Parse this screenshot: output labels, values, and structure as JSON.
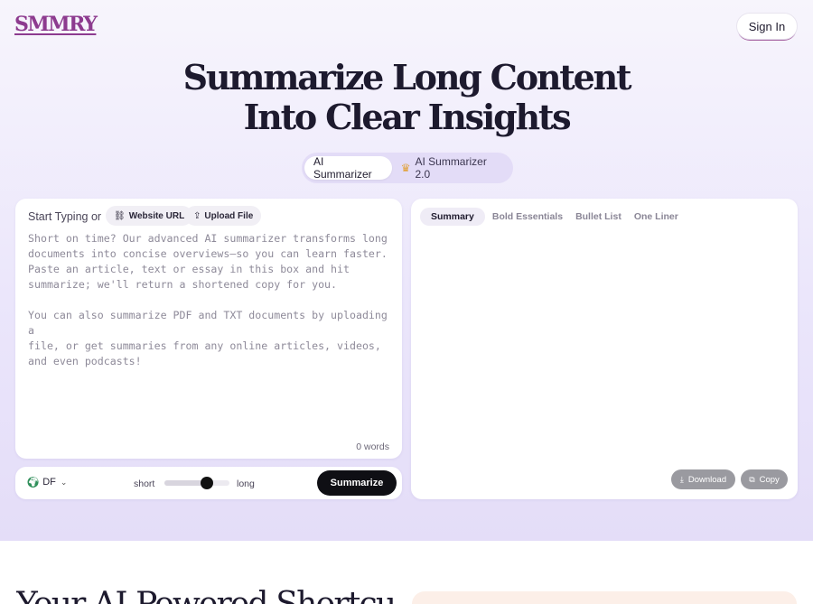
{
  "header": {
    "logo": "SMMRY",
    "signin_label": "Sign In"
  },
  "hero": {
    "title_line1": "Summarize Long Content",
    "title_line2_part1": "Into ",
    "title_line2_part2": "Clear Insights"
  },
  "mode_toggle": {
    "options": [
      {
        "label": "AI Summarizer",
        "active": true
      },
      {
        "label": "AI Summarizer 2.0",
        "icon": "crown-icon",
        "active": false
      }
    ]
  },
  "input": {
    "start_label": "Start Typing or",
    "website_url_label": "Website URL",
    "upload_file_label": "Upload File",
    "placeholder": "Short on time? Our advanced AI summarizer transforms long\ndocuments into concise overviews—so you can learn faster.\nPaste an article, text or essay in this box and hit\nsummarize; we'll return a shortened copy for you.\n\nYou can also summarize PDF and TXT documents by uploading a\nfile, or get summaries from any online articles, videos,\nand even podcasts!",
    "word_count": "0 words"
  },
  "controls": {
    "language": "DF",
    "short_label": "short",
    "long_label": "long",
    "length_level": 0.65,
    "summarize_label": "Summarize"
  },
  "output": {
    "tabs": [
      {
        "label": "Summary",
        "active": true
      },
      {
        "label": "Bold Essentials",
        "active": false
      },
      {
        "label": "Bullet List",
        "active": false
      },
      {
        "label": "One Liner",
        "active": false
      }
    ],
    "download_label": "Download",
    "copy_label": "Copy"
  },
  "section2": {
    "title": "Your AI-Powered Shortcut"
  },
  "colors": {
    "brand": "#8d3b8f",
    "hero_bg_top": "#f7f5fc",
    "hero_bg_bottom": "#e4ddf8",
    "primary_button": "#0f0f14",
    "disabled_button": "#9a9aa0",
    "crown": "#e2a23b"
  }
}
